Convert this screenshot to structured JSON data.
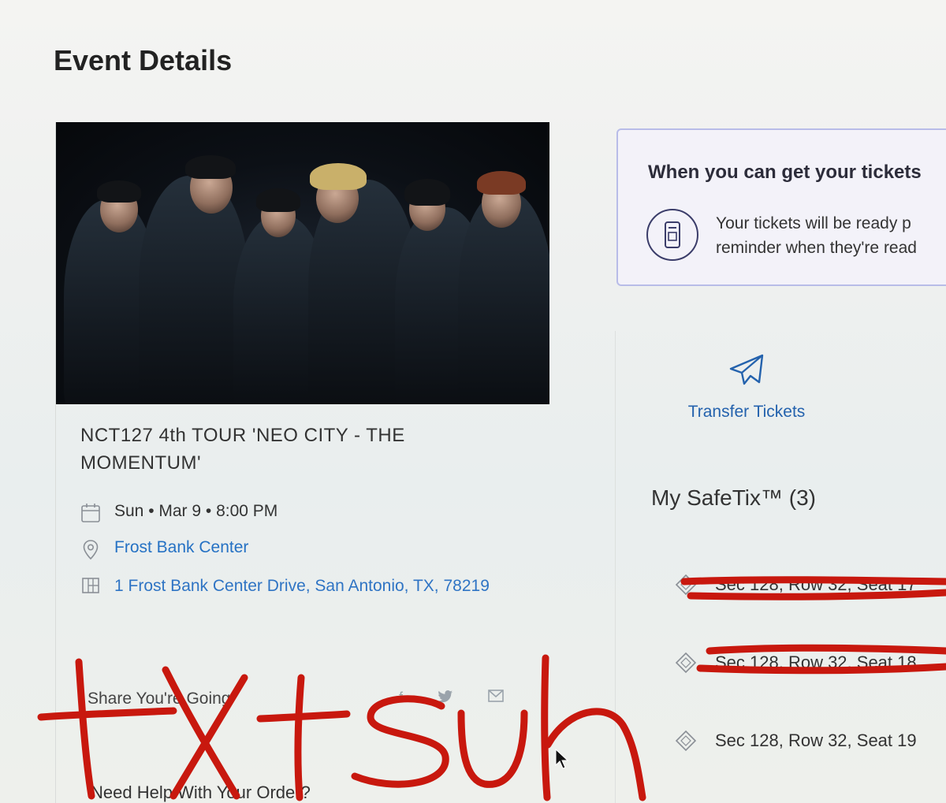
{
  "page": {
    "title": "Event Details"
  },
  "event": {
    "name": "NCT127 4th TOUR 'NEO CITY - THE MOMENTUM'",
    "date_time": "Sun • Mar 9 • 8:00 PM",
    "venue": "Frost Bank Center",
    "address": "1 Frost Bank Center Drive, San Antonio, TX, 78219"
  },
  "share": {
    "label": "Share You're Going",
    "icons": [
      "facebook-icon",
      "twitter-icon",
      "email-icon"
    ]
  },
  "help": {
    "label": "Need Help With Your Order?"
  },
  "notice": {
    "title": "When you can get your tickets",
    "text_line1": "Your tickets will be ready p",
    "text_line2": "reminder when they're read"
  },
  "transfer": {
    "label": "Transfer Tickets"
  },
  "safetix": {
    "heading": "My SafeTix™ (3)",
    "tickets": [
      {
        "label": "Sec 128, Row 32, Seat 17"
      },
      {
        "label": "Sec 128, Row 32, Seat 18"
      },
      {
        "label": "Sec 128, Row 32, Seat 19"
      }
    ]
  },
  "annotation": {
    "handwriting": "txtsuh"
  },
  "colors": {
    "link": "#2571c4",
    "notice_border": "#b8bce8",
    "scribble": "#c8180e"
  }
}
